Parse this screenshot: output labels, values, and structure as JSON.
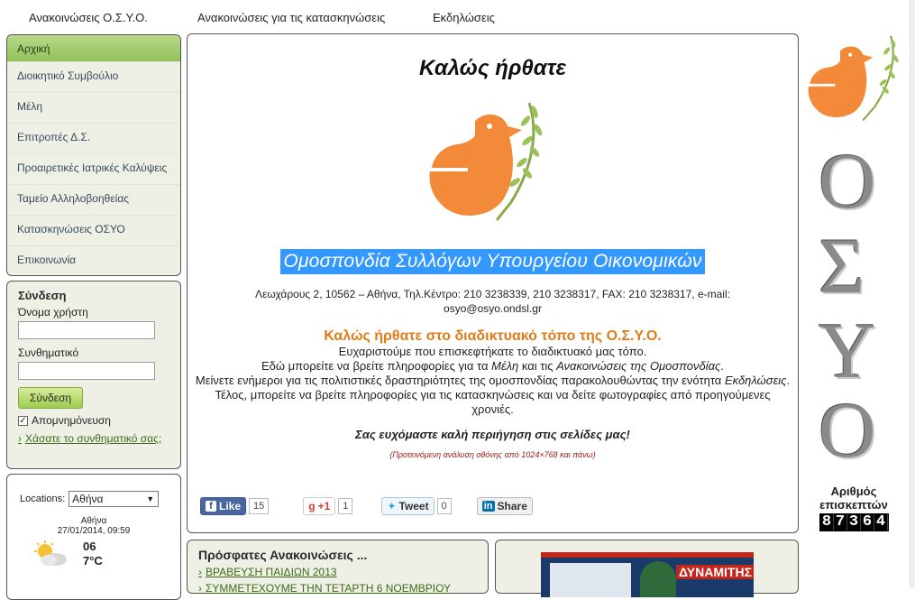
{
  "topnav": {
    "items": [
      "Ανακοινώσεις Ο.Σ.Υ.Ο.",
      "Ανακοινώσεις για τις κατασκηνώσεις",
      "Εκδηλώσεις"
    ]
  },
  "sidebar": {
    "items": [
      {
        "label": "Αρχική"
      },
      {
        "label": "Διοικητικό Συμβούλιο"
      },
      {
        "label": "Μέλη"
      },
      {
        "label": "Επιτροπές Δ.Σ."
      },
      {
        "label": "Προαιρετικές Ιατρικές Καλύψεις"
      },
      {
        "label": "Ταμείο Αλληλοβοηθείας"
      },
      {
        "label": "Κατασκηνώσεις ΟΣΥΟ"
      },
      {
        "label": "Επικοινωνία"
      }
    ]
  },
  "login": {
    "title": "Σύνδεση",
    "username_label": "Όνομα χρήστη",
    "password_label": "Συνθηματικό",
    "submit": "Σύνδεση",
    "remember": "Απομνημόνευση",
    "forgot": "Χάσατε το συνθηματικό σας;"
  },
  "weather": {
    "locations_label": "Locations:",
    "selected": "Αθήνα",
    "city": "Αθήνα",
    "datetime": "27/01/2014, 09:59",
    "high": "06",
    "low": "7°C"
  },
  "main": {
    "welcome": "Καλώς ήρθατε",
    "federation": "Ομοσπονδία Συλλόγων Υπουργείου Οικονομικών",
    "address": "Λεωχάρους 2, 10562 – Αθήνα, Τηλ.Κέντρο: 210 3238339, 210 3238317, FAX: 210 3238317, e-mail: osyo@osyo.ondsl.gr",
    "welcome_site": "Καλώς ήρθατε στο διαδικτυακό τόπο της Ο.Σ.Υ.Ο.",
    "p1": "Ευχαριστούμε που επισκεφτήκατε το διαδικτυακό μας τόπο.",
    "p2_a": "Εδώ μπορείτε να βρείτε πληροφορίες για τα ",
    "p2_b": "Μέλη",
    "p2_c": " και τις ",
    "p2_d": "Ανακοινώσεις της Ομοσπονδίας",
    "p2_e": ".",
    "p3_a": "Μείνετε ενήμεροι για τις πολιτιστικές δραστηριότητες της ομοσπονδίας παρακολουθώντας την ενότητα ",
    "p3_b": "Εκδηλώσεις",
    "p3_c": ".",
    "p4": "Τέλος, μπορείτε να βρείτε πληροφορίες για τις κατασκηνώσεις και να δείτε φωτογραφίες από προηγούμενες χρονιές.",
    "wish": "Σας ευχόμαστε καλή περιήγηση στις σελίδες μας!",
    "recommend": "(Προτεινόμενη ανάλυση οθόνης από 1024×768 και πάνω)"
  },
  "social": {
    "like": "Like",
    "like_count": "15",
    "gplus": "+1",
    "gplus_count": "1",
    "tweet": "Tweet",
    "tweet_count": "0",
    "share": "Share"
  },
  "news": {
    "title": "Πρόσφατες Ανακοινώσεις ...",
    "items": [
      "ΒΡΑΒΕΥΣΗ ΠΑΙΔΙΩΝ 2013",
      "ΣΥΜΜΕΤΕΧΟΥΜΕ ΤΗΝ ΤΕΤΑΡΤΗ 6 ΝΟΕΜΒΡΙΟΥ"
    ]
  },
  "magazine": {
    "headline": "ΔΥΝΑΜΙΤΗΣ"
  },
  "right": {
    "letters": [
      "Ο",
      "Σ",
      "Υ",
      "Ο"
    ],
    "visits_label": "Αριθμός επισκεπτών",
    "visits": "87364"
  },
  "colors": {
    "accent_green": "#93c25b",
    "dove_orange": "#f28a3a",
    "title_orange": "#e07b1a",
    "highlight_blue": "#3399ff"
  }
}
